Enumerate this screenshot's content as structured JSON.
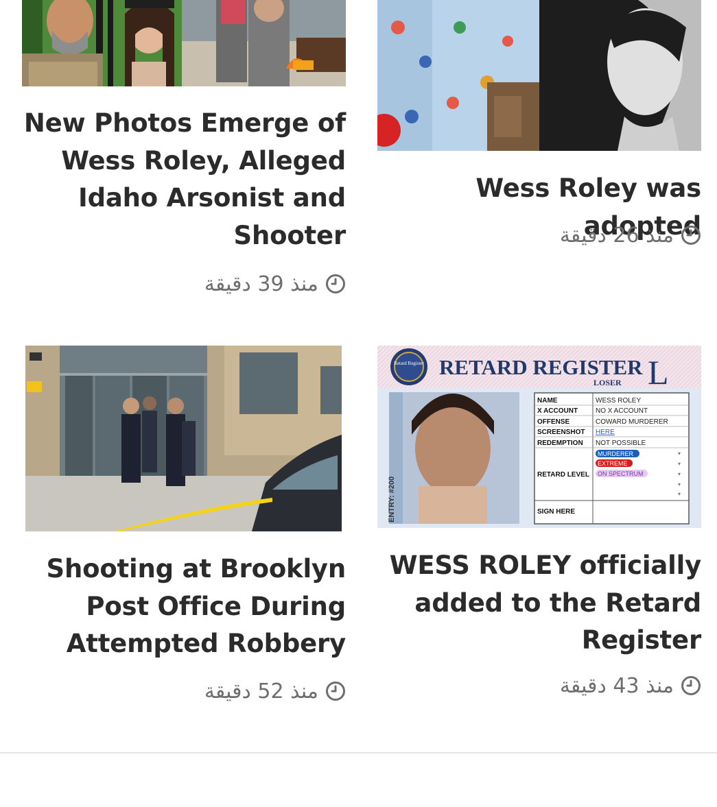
{
  "articles": [
    {
      "title": "New Photos Emerge of Wess Roley, Alleged Idaho Arsonist and Shooter",
      "time": "منذ 39 دقيقة"
    },
    {
      "title": "Wess Roley was adopted",
      "time": "منذ 26 دقيقة"
    },
    {
      "title": "Shooting at Brooklyn Post Office During Attempted Robbery",
      "time": "منذ 52 دقيقة"
    },
    {
      "title": "WESS ROLEY officially added to the Retard Register",
      "time": "منذ 43 دقيقة"
    }
  ],
  "register_card": {
    "heading": "RETARD REGISTER",
    "subheading": "LOSER",
    "badge_letter": "L",
    "seal_text": "Retard Register",
    "entry_label": "ENTRY: #200",
    "fields": [
      {
        "label": "NAME",
        "value": "WESS ROLEY"
      },
      {
        "label": "X ACCOUNT",
        "value": "NO X ACCOUNT"
      },
      {
        "label": "OFFENSE",
        "value": "COWARD MURDERER"
      },
      {
        "label": "SCREENSHOT",
        "value": "HERE"
      },
      {
        "label": "REDEMPTION",
        "value": "NOT POSSIBLE"
      }
    ],
    "level_label": "RETARD LEVEL",
    "level_tags": [
      "MURDERER",
      "EXTREME",
      "ON SPECTRUM"
    ],
    "sign_label": "SIGN HERE",
    "colors": {
      "heading": "#1f3a6b",
      "tag_murderer": "#1c5fb8",
      "tag_extreme": "#d81b1b",
      "tag_spectrum": "#c9a2e0",
      "link": "#2f5fd0"
    }
  },
  "icons": {
    "time": "clock-icon"
  }
}
